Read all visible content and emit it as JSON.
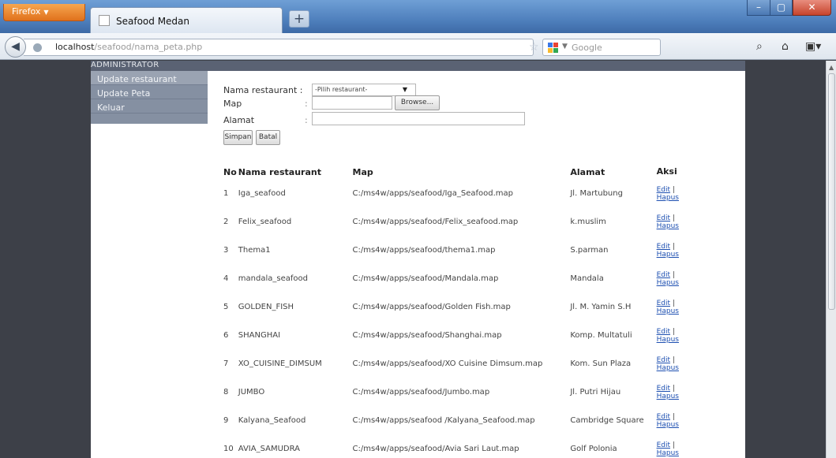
{
  "browser": {
    "menu_button": "Firefox",
    "tab_title": "Seafood Medan",
    "new_tab": "+",
    "url_host": "localhost",
    "url_path": "/seafood/nama_peta.php",
    "search_placeholder": "Google",
    "window_controls": {
      "minimize": "–",
      "maximize": "▢",
      "close": "✕"
    }
  },
  "admin": {
    "header": "ADMINISTRATOR",
    "menu": [
      {
        "label": "Update restaurant"
      },
      {
        "label": "Update Peta"
      },
      {
        "label": "Keluar"
      }
    ]
  },
  "form": {
    "restaurant_label": "Nama restaurant :",
    "restaurant_select": "-Pilih restaurant-",
    "map_label": "Map",
    "map_colon": ":",
    "browse_button": "Browse...",
    "alamat_label": "Alamat",
    "alamat_colon": ":",
    "alamat_value": "",
    "save_button": "Simpan",
    "reset_button": "Batal"
  },
  "table": {
    "headers": {
      "no": "No",
      "name": "Nama restaurant",
      "map": "Map",
      "alamat": "Alamat",
      "aksi": "Aksi"
    },
    "edit_label": "Edit",
    "delete_label": "Hapus",
    "separator": "|",
    "rows": [
      {
        "no": "1",
        "name": "Iga_seafood",
        "map": "C:/ms4w/apps/seafood/Iga_Seafood.map",
        "alamat": "Jl. Martubung"
      },
      {
        "no": "2",
        "name": "Felix_seafood",
        "map": "C:/ms4w/apps/seafood/Felix_seafood.map",
        "alamat": "k.muslim"
      },
      {
        "no": "3",
        "name": "Thema1",
        "map": "C:/ms4w/apps/seafood/thema1.map",
        "alamat": "S.parman"
      },
      {
        "no": "4",
        "name": "mandala_seafood",
        "map": "C:/ms4w/apps/seafood/Mandala.map",
        "alamat": "Mandala"
      },
      {
        "no": "5",
        "name": "GOLDEN_FISH",
        "map": "C:/ms4w/apps/seafood/Golden Fish.map",
        "alamat": "Jl. M. Yamin S.H"
      },
      {
        "no": "6",
        "name": "SHANGHAI",
        "map": "C:/ms4w/apps/seafood/Shanghai.map",
        "alamat": "Komp. Multatuli"
      },
      {
        "no": "7",
        "name": "XO_CUISINE_DIMSUM",
        "map": "C:/ms4w/apps/seafood/XO Cuisine Dimsum.map",
        "alamat": "Kom. Sun Plaza"
      },
      {
        "no": "8",
        "name": "JUMBO",
        "map": "C:/ms4w/apps/seafood/Jumbo.map",
        "alamat": "Jl. Putri Hijau"
      },
      {
        "no": "9",
        "name": "Kalyana_Seafood",
        "map": "C:/ms4w/apps/seafood /Kalyana_Seafood.map",
        "alamat": "Cambridge Square"
      },
      {
        "no": "10",
        "name": "AVIA_SAMUDRA",
        "map": "C:/ms4w/apps/seafood/Avia Sari Laut.map",
        "alamat": "Golf Polonia"
      }
    ]
  }
}
